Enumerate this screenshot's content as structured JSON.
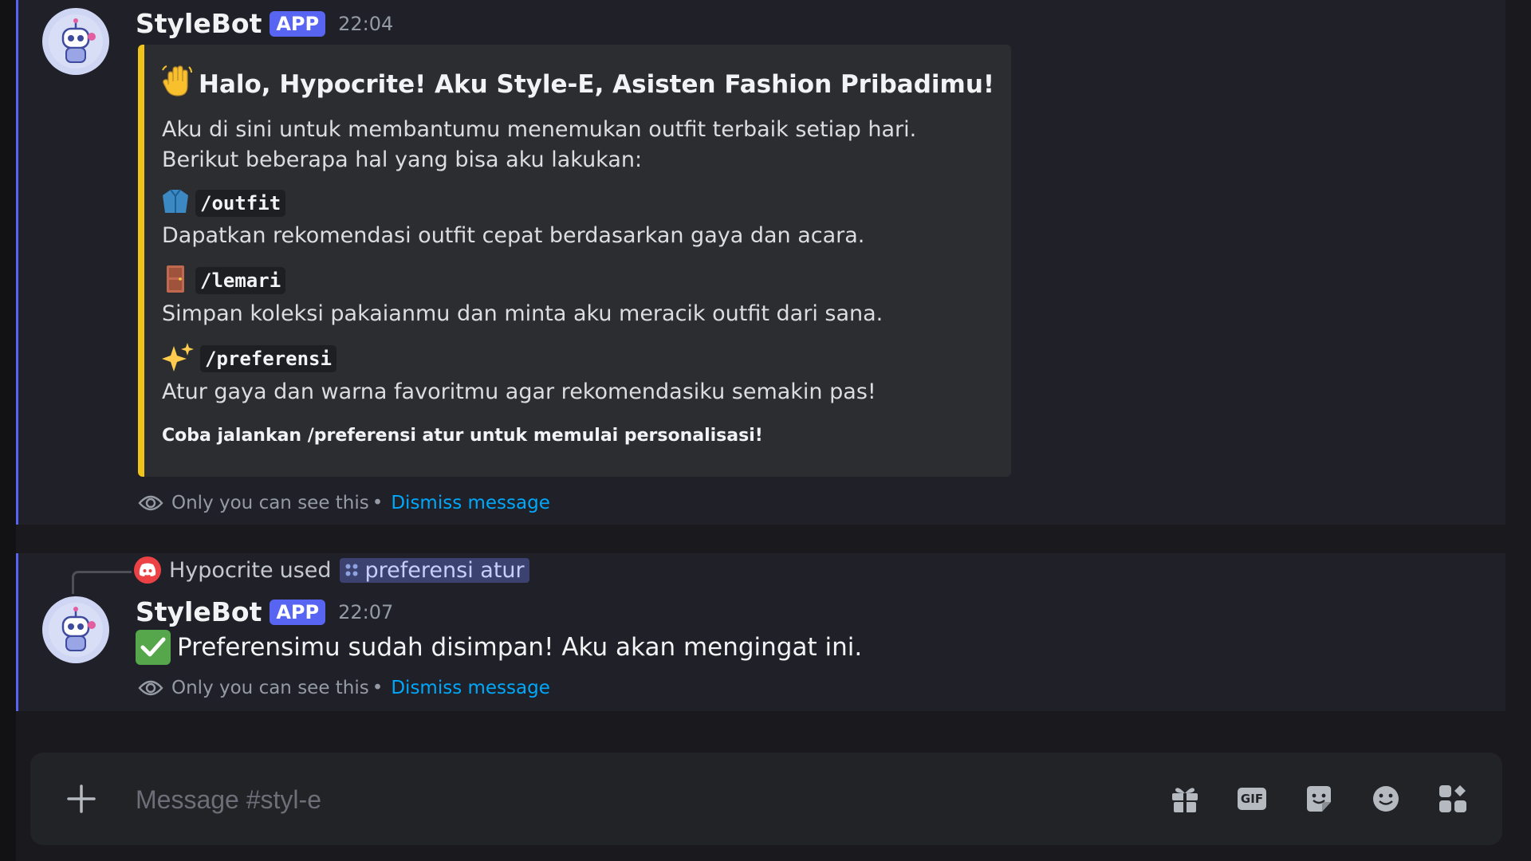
{
  "messages": [
    {
      "username": "StyleBot",
      "badge": "APP",
      "time": "22:04",
      "embed": {
        "title_emoji": "waving-hand",
        "title": "Halo, Hypocrite! Aku Style-E, Asisten Fashion Pribadimu!",
        "description": "Aku di sini untuk membantumu menemukan outfit terbaik setiap hari. Berikut beberapa hal yang bisa aku lakukan:",
        "commands": [
          {
            "icon": "coat-icon",
            "command": "/outfit",
            "description": "Dapatkan rekomendasi outfit cepat berdasarkan gaya dan acara."
          },
          {
            "icon": "door-icon",
            "command": "/lemari",
            "description": "Simpan koleksi pakaianmu dan minta aku meracik outfit dari sana."
          },
          {
            "icon": "sparkles-icon",
            "command": "/preferensi",
            "description": "Atur gaya dan warna favoritmu agar rekomendasiku semakin pas!"
          }
        ],
        "footer": "Coba jalankan /preferensi atur untuk memulai personalisasi!",
        "accent_color": "#f0c419"
      },
      "visibility_note": "Only you can see this",
      "separator": "•",
      "dismiss_label": "Dismiss message"
    },
    {
      "reply": {
        "user": "Hypocrite",
        "action": "used",
        "command": "preferensi atur"
      },
      "username": "StyleBot",
      "badge": "APP",
      "time": "22:07",
      "content": "Preferensimu sudah disimpan! Aku akan mengingat ini.",
      "visibility_note": "Only you can see this",
      "separator": "•",
      "dismiss_label": "Dismiss message"
    }
  ],
  "composer": {
    "placeholder": "Message #styl-e",
    "gif_label": "GIF",
    "icons": [
      "plus-icon",
      "gift-icon",
      "gif-icon",
      "sticker-icon",
      "emoji-icon",
      "apps-icon"
    ]
  },
  "colors": {
    "background": "#1a1a1e",
    "ephemeral_highlight": "#5865f2",
    "link": "#00a8fc",
    "app_badge": "#5865f2"
  }
}
